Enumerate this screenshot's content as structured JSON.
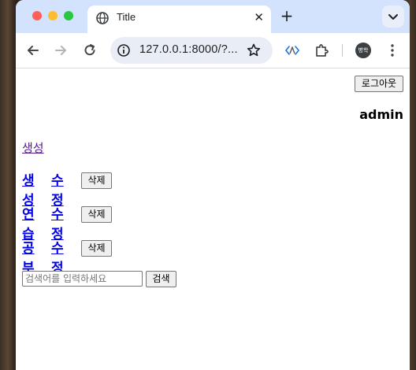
{
  "browser": {
    "tab_title": "Title",
    "tab_close": "✕",
    "new_tab": "+",
    "url": "127.0.0.1:8000/?...",
    "profile_initials": "병학",
    "icons": [
      "globe-icon",
      "close-icon",
      "plus-icon",
      "chevron-down-icon",
      "back-arrow-icon",
      "forward-arrow-icon",
      "reload-icon",
      "info-icon",
      "star-icon",
      "extension-icon",
      "puzzle-icon",
      "kebab-menu-icon"
    ]
  },
  "header": {
    "logout_label": "로그아웃",
    "username": "admin"
  },
  "main": {
    "create_link": "생성",
    "items": [
      {
        "title": "생성",
        "edit": "수정",
        "delete": "삭제"
      },
      {
        "title": "연습",
        "edit": "수정",
        "delete": "삭제"
      },
      {
        "title": "공부",
        "edit": "수정",
        "delete": "삭제"
      }
    ]
  },
  "search": {
    "placeholder": "검색어를 입력하세요",
    "value": "",
    "button": "검색"
  },
  "colors": {
    "tabstrip": "#d3e3fd",
    "link": "#0000ee",
    "visited_link": "#551a8b"
  }
}
